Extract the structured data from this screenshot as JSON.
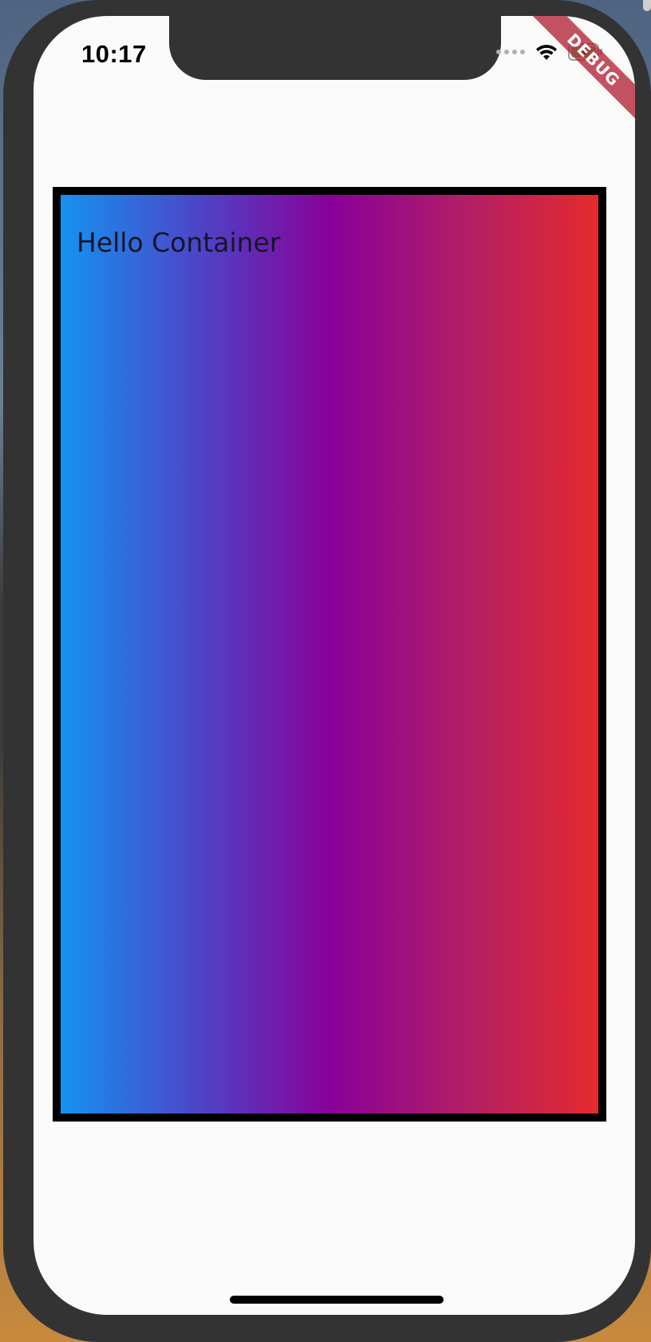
{
  "status_bar": {
    "time": "10:17",
    "icons": [
      "cellular-signal-icon",
      "wifi-icon",
      "battery-charging-icon"
    ]
  },
  "debug_banner": {
    "label": "DEBUG"
  },
  "container": {
    "text": "Hello Container",
    "gradient_colors": [
      "#1592f0",
      "#880099",
      "#e52a2c"
    ],
    "border_color": "#000000"
  },
  "colors": {
    "screen_background": "#fafafa",
    "device_frame": "#333333"
  }
}
